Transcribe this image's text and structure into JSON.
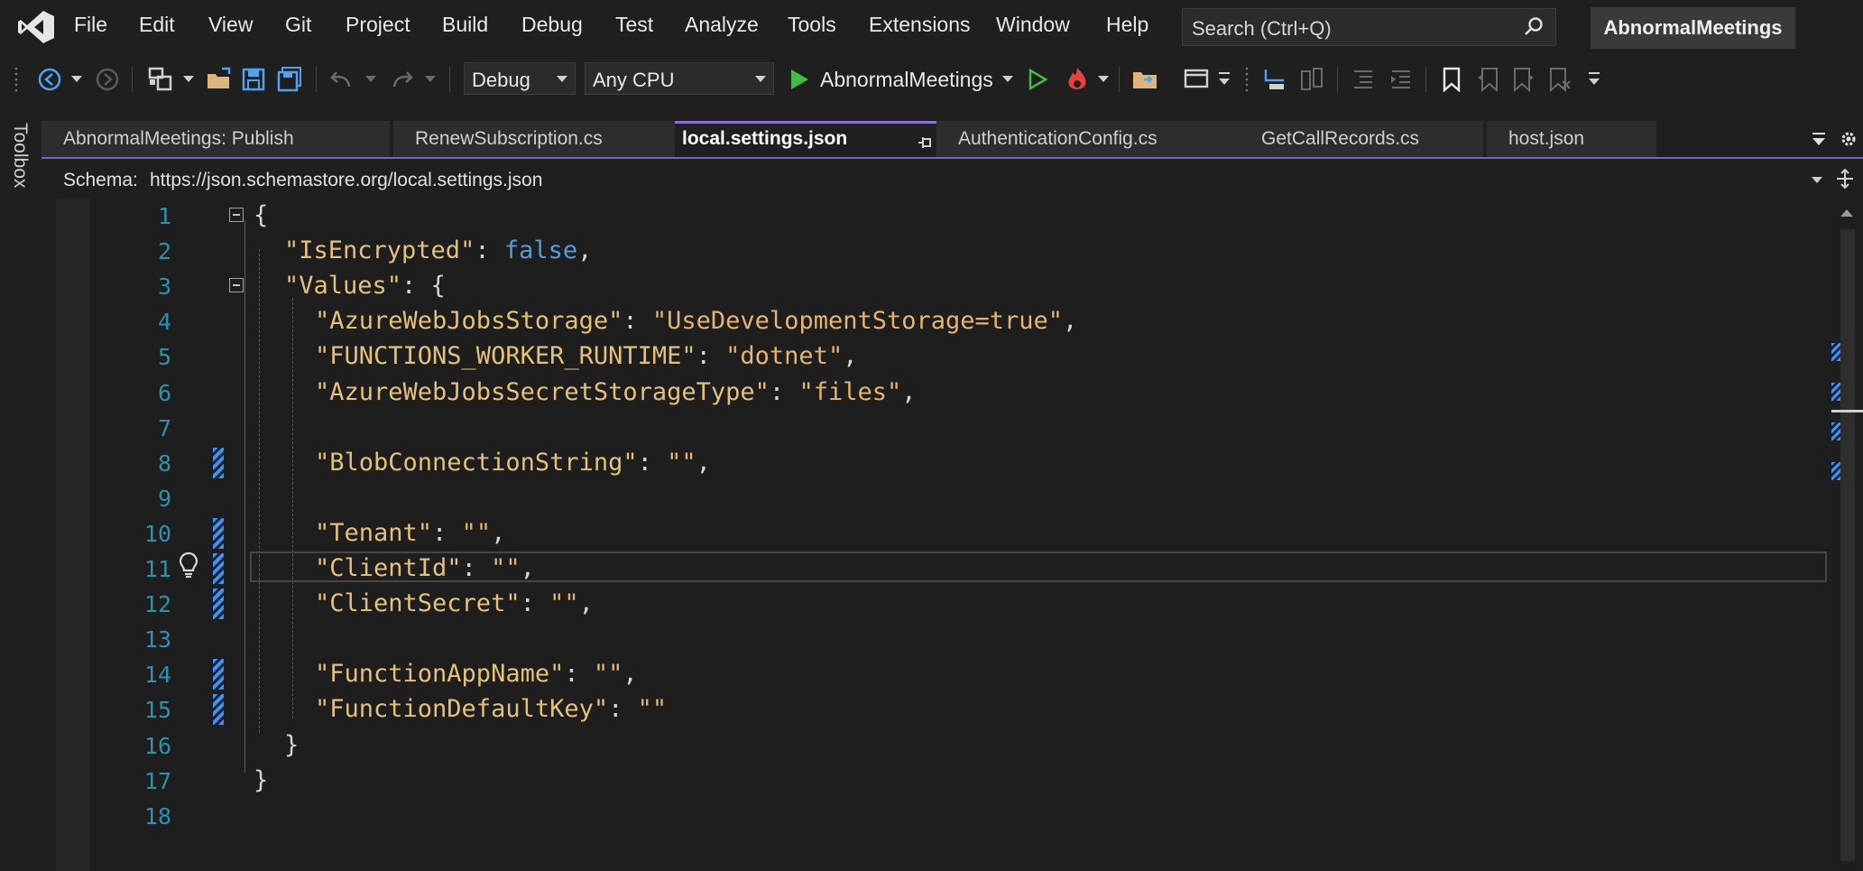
{
  "menu": {
    "items": [
      "File",
      "Edit",
      "View",
      "Git",
      "Project",
      "Build",
      "Debug",
      "Test",
      "Analyze",
      "Tools",
      "Extensions",
      "Window",
      "Help"
    ]
  },
  "search": {
    "placeholder": "Search (Ctrl+Q)"
  },
  "solution_title": "AbnormalMeetings",
  "toolbar": {
    "configuration": "Debug",
    "platform": "Any CPU",
    "run_target": "AbnormalMeetings"
  },
  "toolbox_label": "Toolbox",
  "tabs": [
    {
      "label": "AbnormalMeetings: Publish",
      "active": false
    },
    {
      "label": "RenewSubscription.cs",
      "active": false
    },
    {
      "label": "local.settings.json",
      "active": true
    },
    {
      "label": "AuthenticationConfig.cs",
      "active": false
    },
    {
      "label": "GetCallRecords.cs",
      "active": false
    },
    {
      "label": "host.json",
      "active": false
    }
  ],
  "schema": {
    "label": "Schema:",
    "url": "https://json.schemastore.org/local.settings.json"
  },
  "editor": {
    "current_line": 11,
    "lines": [
      {
        "n": "1",
        "tokens": [
          [
            "p",
            "{"
          ]
        ]
      },
      {
        "n": "2",
        "tokens": [
          [
            "k",
            "\"IsEncrypted\""
          ],
          [
            "p",
            ": "
          ],
          [
            "kw",
            "false"
          ],
          [
            "p",
            ","
          ]
        ]
      },
      {
        "n": "3",
        "tokens": [
          [
            "k",
            "\"Values\""
          ],
          [
            "p",
            ": {"
          ]
        ]
      },
      {
        "n": "4",
        "tokens": [
          [
            "k",
            "\"AzureWebJobsStorage\""
          ],
          [
            "p",
            ": "
          ],
          [
            "s",
            "\"UseDevelopmentStorage=true\""
          ],
          [
            "p",
            ","
          ]
        ]
      },
      {
        "n": "5",
        "tokens": [
          [
            "k",
            "\"FUNCTIONS_WORKER_RUNTIME\""
          ],
          [
            "p",
            ": "
          ],
          [
            "s",
            "\"dotnet\""
          ],
          [
            "p",
            ","
          ]
        ]
      },
      {
        "n": "6",
        "tokens": [
          [
            "k",
            "\"AzureWebJobsSecretStorageType\""
          ],
          [
            "p",
            ": "
          ],
          [
            "s",
            "\"files\""
          ],
          [
            "p",
            ","
          ]
        ]
      },
      {
        "n": "7",
        "tokens": []
      },
      {
        "n": "8",
        "tokens": [
          [
            "k",
            "\"BlobConnectionString\""
          ],
          [
            "p",
            ": "
          ],
          [
            "s",
            "\"\""
          ],
          [
            "p",
            ","
          ]
        ]
      },
      {
        "n": "9",
        "tokens": []
      },
      {
        "n": "10",
        "tokens": [
          [
            "k",
            "\"Tenant\""
          ],
          [
            "p",
            ": "
          ],
          [
            "s",
            "\"\""
          ],
          [
            "p",
            ","
          ]
        ]
      },
      {
        "n": "11",
        "tokens": [
          [
            "k",
            "\"ClientId\""
          ],
          [
            "p",
            ": "
          ],
          [
            "s",
            "\"\""
          ],
          [
            "p",
            ","
          ]
        ]
      },
      {
        "n": "12",
        "tokens": [
          [
            "k",
            "\"ClientSecret\""
          ],
          [
            "p",
            ": "
          ],
          [
            "s",
            "\"\""
          ],
          [
            "p",
            ","
          ]
        ]
      },
      {
        "n": "13",
        "tokens": []
      },
      {
        "n": "14",
        "tokens": [
          [
            "k",
            "\"FunctionAppName\""
          ],
          [
            "p",
            ": "
          ],
          [
            "s",
            "\"\""
          ],
          [
            "p",
            ","
          ]
        ]
      },
      {
        "n": "15",
        "tokens": [
          [
            "k",
            "\"FunctionDefaultKey\""
          ],
          [
            "p",
            ": "
          ],
          [
            "s",
            "\"\""
          ]
        ]
      },
      {
        "n": "16",
        "tokens": [
          [
            "p",
            "}"
          ]
        ]
      },
      {
        "n": "17",
        "tokens": [
          [
            "p",
            "}"
          ]
        ]
      },
      {
        "n": "18",
        "tokens": []
      }
    ]
  },
  "colors": {
    "accent": "#8c6fd8",
    "line_number": "#2b91af",
    "json_key": "#e5c07b",
    "json_string": "#e6b472",
    "json_keyword": "#569cd6",
    "modified_marker": "#3794ff"
  },
  "icons": [
    "visual-studio-logo",
    "search-icon",
    "back-icon",
    "forward-icon",
    "solution-explorer-icon",
    "open-folder-icon",
    "save-icon",
    "save-all-icon",
    "undo-icon",
    "redo-icon",
    "start-icon",
    "start-without-debugging-icon",
    "hot-reload-icon",
    "bookmark-icon",
    "settings-icon",
    "lightbulb-icon"
  ]
}
